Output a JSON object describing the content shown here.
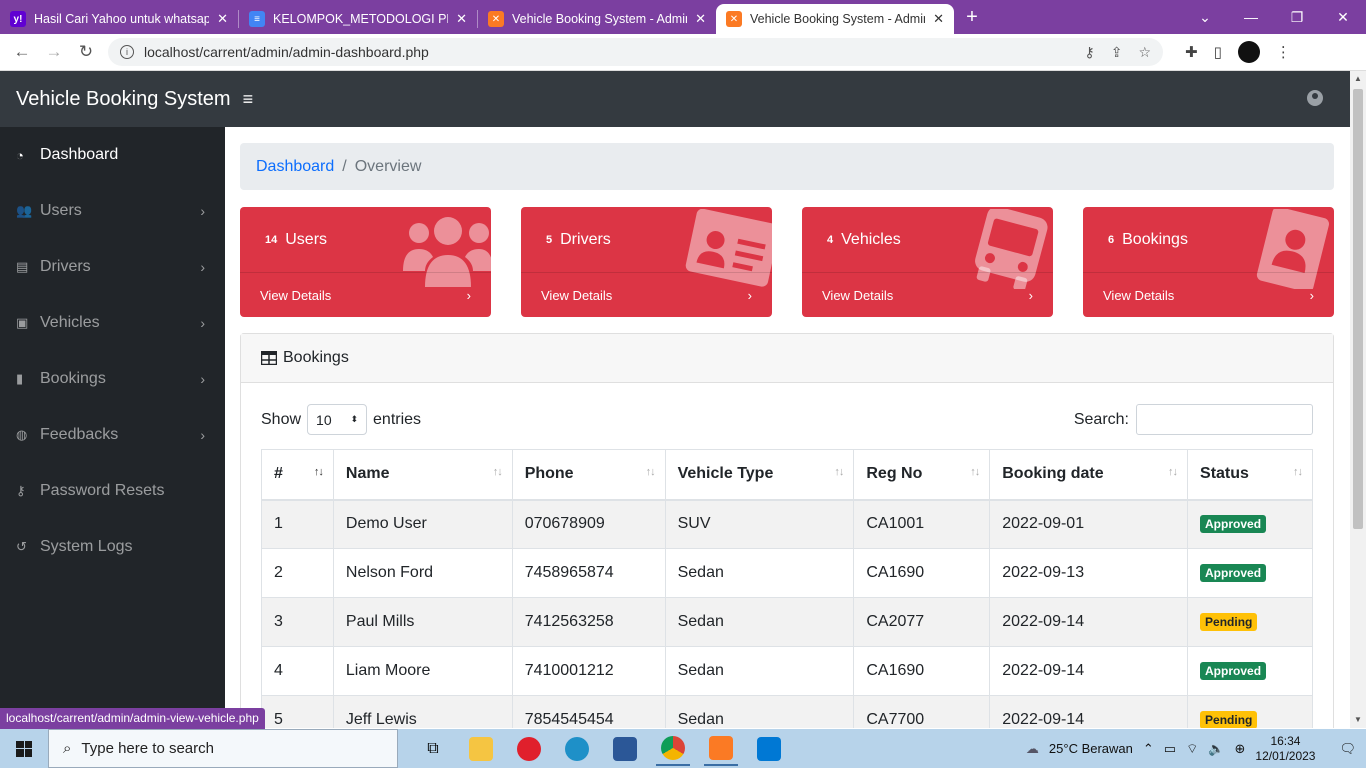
{
  "browser": {
    "tabs": [
      {
        "title": "Hasil Cari Yahoo untuk whatsapp",
        "icon": "yahoo-icon",
        "active": false
      },
      {
        "title": "KELOMPOK_METODOLOGI PENG",
        "icon": "docs-icon",
        "active": false
      },
      {
        "title": "Vehicle Booking System - Admin",
        "icon": "xampp-icon",
        "active": false
      },
      {
        "title": "Vehicle Booking System - Admin",
        "icon": "xampp-icon",
        "active": true
      }
    ],
    "url": "localhost/carrent/admin/admin-dashboard.php",
    "status_url": "localhost/carrent/admin/admin-view-vehicle.php"
  },
  "app": {
    "brand": "Vehicle Booking System",
    "menu_icon": "≡"
  },
  "sidebar": {
    "items": [
      {
        "label": "Dashboard",
        "icon": "dashboard-icon",
        "glyph": "◔",
        "chevron": ""
      },
      {
        "label": "Users",
        "icon": "users-icon",
        "glyph": "👥",
        "chevron": "›"
      },
      {
        "label": "Drivers",
        "icon": "id-card-icon",
        "glyph": "▤",
        "chevron": "›"
      },
      {
        "label": "Vehicles",
        "icon": "bus-icon",
        "glyph": "▣",
        "chevron": "›"
      },
      {
        "label": "Bookings",
        "icon": "book-icon",
        "glyph": "▮",
        "chevron": "›"
      },
      {
        "label": "Feedbacks",
        "icon": "comments-icon",
        "glyph": "◍",
        "chevron": "›"
      },
      {
        "label": "Password Resets",
        "icon": "key-icon",
        "glyph": "⚷",
        "chevron": ""
      },
      {
        "label": "System Logs",
        "icon": "history-icon",
        "glyph": "↺",
        "chevron": ""
      }
    ]
  },
  "breadcrumb": {
    "link": "Dashboard",
    "current": "Overview"
  },
  "cards": [
    {
      "count": "14",
      "label": "Users",
      "footer": "View Details",
      "icon": "users-icon"
    },
    {
      "count": "5",
      "label": "Drivers",
      "footer": "View Details",
      "icon": "id-card-icon"
    },
    {
      "count": "4",
      "label": "Vehicles",
      "footer": "View Details",
      "icon": "bus-icon"
    },
    {
      "count": "6",
      "label": "Bookings",
      "footer": "View Details",
      "icon": "user-badge-icon"
    }
  ],
  "bookings_panel": {
    "title": "Bookings",
    "show_label": "Show",
    "entries_value": "10",
    "entries_label": "entries",
    "search_label": "Search:",
    "search_value": "",
    "columns": [
      "#",
      "Name",
      "Phone",
      "Vehicle Type",
      "Reg No",
      "Booking date",
      "Status"
    ],
    "rows": [
      {
        "num": "1",
        "name": "Demo User",
        "phone": "070678909",
        "type": "SUV",
        "reg": "CA1001",
        "date": "2022-09-01",
        "status": "Approved"
      },
      {
        "num": "2",
        "name": "Nelson Ford",
        "phone": "7458965874",
        "type": "Sedan",
        "reg": "CA1690",
        "date": "2022-09-13",
        "status": "Approved"
      },
      {
        "num": "3",
        "name": "Paul Mills",
        "phone": "7412563258",
        "type": "Sedan",
        "reg": "CA2077",
        "date": "2022-09-14",
        "status": "Pending"
      },
      {
        "num": "4",
        "name": "Liam Moore",
        "phone": "7410001212",
        "type": "Sedan",
        "reg": "CA1690",
        "date": "2022-09-14",
        "status": "Approved"
      },
      {
        "num": "5",
        "name": "Jeff Lewis",
        "phone": "7854545454",
        "type": "Sedan",
        "reg": "CA7700",
        "date": "2022-09-14",
        "status": "Pending"
      }
    ]
  },
  "taskbar": {
    "search_placeholder": "Type here to search",
    "weather": "25°C  Berawan",
    "time": "16:34",
    "date": "12/01/2023"
  },
  "colors": {
    "card_red": "#dc3545",
    "sidebar": "#212529",
    "navbar": "#343a40",
    "approved": "#198754",
    "pending": "#ffc107",
    "chrome_frame": "#7b3fa0"
  }
}
